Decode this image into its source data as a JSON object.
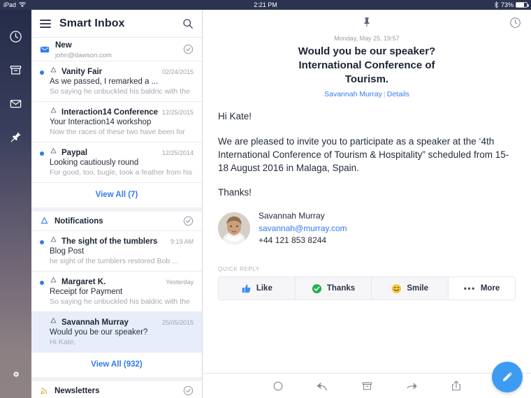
{
  "status_bar": {
    "device": "iPad",
    "wifi_icon": "wifi-icon",
    "time": "2:21 PM",
    "bluetooth_icon": "bluetooth-icon",
    "battery_percent": "73%"
  },
  "rail": {
    "items": [
      {
        "icon": "clock-icon",
        "name": "rail-item-snoozed"
      },
      {
        "icon": "archive-icon",
        "name": "rail-item-archive"
      },
      {
        "icon": "envelope-icon",
        "name": "rail-item-inbox"
      },
      {
        "icon": "pin-icon",
        "name": "rail-item-pinned"
      }
    ],
    "settings_icon": "gear-icon"
  },
  "list": {
    "header": {
      "menu_icon": "hamburger-icon",
      "title": "Smart Inbox",
      "search_icon": "search-icon"
    },
    "sections": [
      {
        "name": "new",
        "icon": "envelope-icon",
        "title": "New",
        "subtitle": "john@dawson.com",
        "action_icon": "check-circle-icon",
        "rows": [
          {
            "unread": true,
            "bell": "bell-icon",
            "sender": "Vanity Fair",
            "date": "02/24/2015",
            "subject": "As we passed, I remarked a ...",
            "preview": "So saying he unbuckled his baldric with the",
            "selected": false
          },
          {
            "unread": false,
            "bell": "bell-icon",
            "sender": "Interaction14 Conference",
            "date": "12/25/2015",
            "subject": "Your Interaction14 workshop",
            "preview": "Now the races of these two have been for",
            "selected": false
          },
          {
            "unread": true,
            "bell": "bell-icon",
            "sender": "Paypal",
            "date": "12/25/2014",
            "subject": "Looking cautiously round",
            "preview": "For good, too; bugle, took a feather from his",
            "selected": false
          }
        ],
        "view_all": "View All (7)"
      },
      {
        "name": "notifications",
        "icon": "bell-icon",
        "title": "Notifications",
        "subtitle": "",
        "action_icon": "check-circle-icon",
        "rows": [
          {
            "unread": true,
            "bell": "bell-icon",
            "sender": "The sight of the tumblers",
            "date": "9:19 AM",
            "subject": "Blog Post",
            "preview": "he sight of the tumblers restored Bob ...",
            "selected": false
          },
          {
            "unread": true,
            "bell": "bell-icon",
            "sender": "Margaret K.",
            "date": "Yesterday",
            "subject": "Receipt for Payment",
            "preview": "So saying he unbuckled his baldric with the",
            "selected": false
          },
          {
            "unread": false,
            "bell": "bell-icon",
            "sender": "Savannah Murray",
            "date": "25/05/2015",
            "subject": "Would you be our speaker?",
            "preview": "Hi Kate,",
            "selected": true
          }
        ],
        "view_all": "View All (932)"
      },
      {
        "name": "newsletters",
        "icon": "rss-icon",
        "title": "Newsletters",
        "subtitle": "",
        "action_icon": "check-circle-icon",
        "rows": [],
        "view_all": ""
      }
    ]
  },
  "reading_pane": {
    "pin_icon": "pin-icon",
    "snooze_icon": "clock-icon",
    "date": "Monday, May 25, 19:57",
    "subject_line_1": "Would you be our speaker?",
    "subject_line_2": "International Conference of",
    "subject_line_3": "Tourism.",
    "from_name": "Savannah Murray",
    "details_link": "Details",
    "body": {
      "greeting": "Hi Kate!",
      "paragraph": "We are pleased to invite you to participate as a speaker at the ‘4th International Conference of Tourism & Hospitality” scheduled from 15-18 August 2016 in Malaga, Spain.",
      "closing": "Thanks!"
    },
    "signature": {
      "avatar": "contact-photo",
      "name": "Savannah Murray",
      "email": "savannah@murray.com",
      "phone": "+44 121 853 8244"
    },
    "quick_reply": {
      "label": "QUICK REPLY",
      "buttons": [
        {
          "icon": "thumbs-up-icon",
          "label": "Like",
          "color": "#3d8ef5"
        },
        {
          "icon": "check-circle-filled-icon",
          "label": "Thanks",
          "color": "#22b14c"
        },
        {
          "icon": "smiley-icon",
          "label": "Smile",
          "color": "#f5c744"
        },
        {
          "icon": "ellipsis-icon",
          "label": "More",
          "color": "#4a5166"
        }
      ]
    },
    "toolbar": [
      {
        "icon": "circle-icon",
        "name": "mark-unread-button"
      },
      {
        "icon": "reply-icon",
        "name": "reply-button"
      },
      {
        "icon": "archive-icon",
        "name": "archive-button"
      },
      {
        "icon": "forward-icon",
        "name": "forward-button"
      },
      {
        "icon": "share-icon",
        "name": "share-button"
      }
    ],
    "compose_icon": "pencil-icon"
  },
  "colors": {
    "accent_blue": "#2f7bf0",
    "fab_blue": "#3d9bf3",
    "rail_top": "#242c49",
    "rail_bottom": "#8f8285",
    "selected_row": "#e7eefa"
  }
}
